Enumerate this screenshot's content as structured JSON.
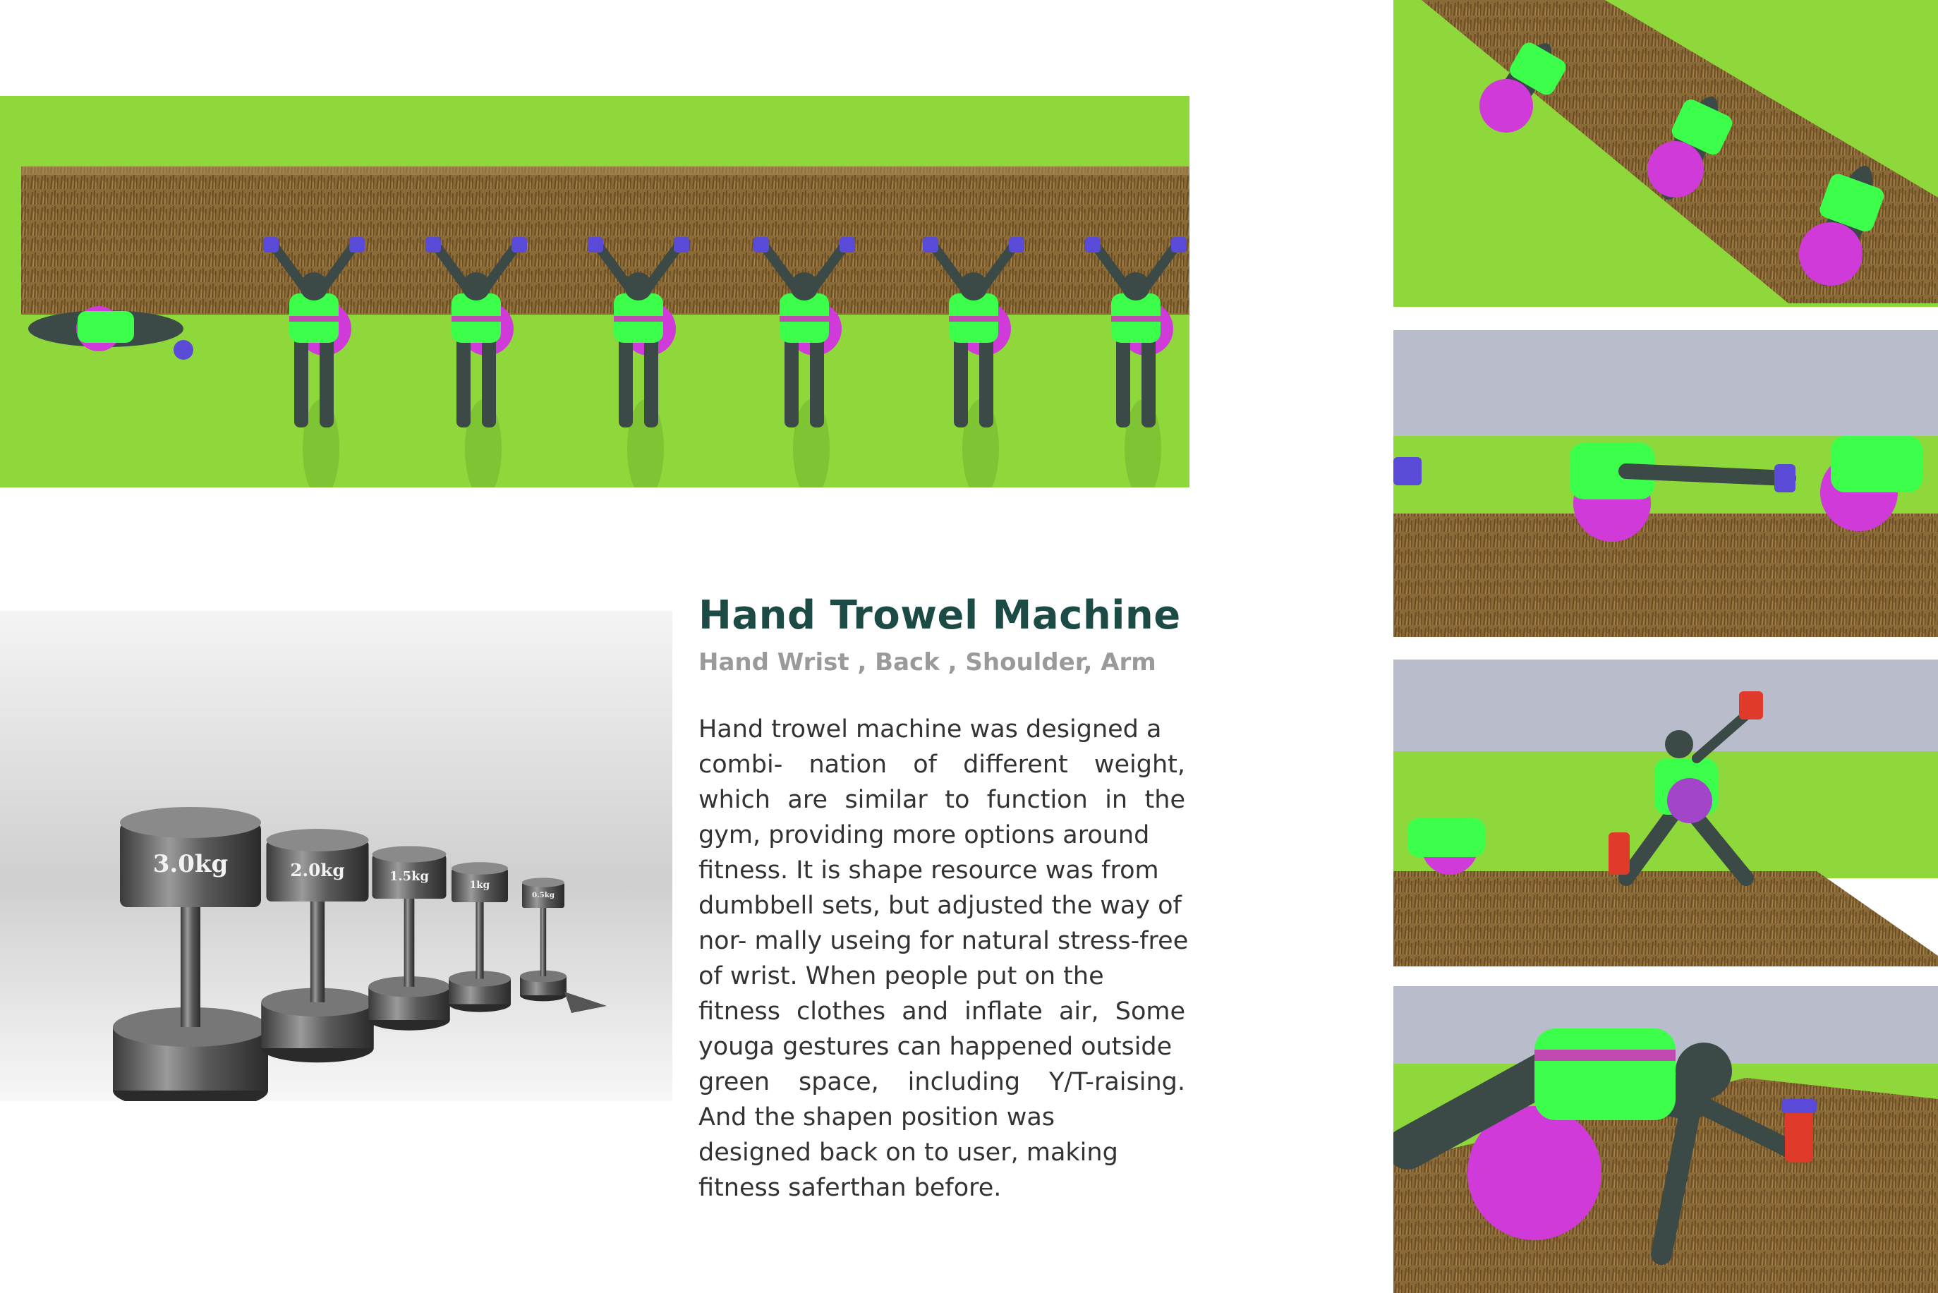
{
  "title": "Hand Trowel Machine",
  "subtitle": "Hand Wrist , Back , Shoulder, Arm",
  "body_lines": [
    "Hand trowel machine was designed a",
    "combi- nation of different weight,",
    "which are similar to function in the",
    "gym, providing more options around",
    "fitness. It is shape resource was from",
    "dumbbell sets, but adjusted the way of",
    "nor- mally useing for natural stress-free",
    "of wrist. When people put on the",
    "fitness clothes and inflate air, Some",
    "youga gestures can happened outside",
    "green space, including Y/T-raising.",
    "And the shapen position was",
    "designed back on to user, making",
    "fitness saferthan before."
  ],
  "weight_labels": [
    "3.0kg",
    "2.0kg",
    "1.5kg",
    "1kg",
    "0.5kg"
  ],
  "colors": {
    "title": "#1c4a44",
    "subtitle": "#9a9a9a",
    "body": "#333333",
    "lawn": "#8fd83c",
    "grass": "#7a5a2e",
    "vest": "#3bff4a",
    "ball": "#d03ad8",
    "figure": "#3b4a47"
  }
}
